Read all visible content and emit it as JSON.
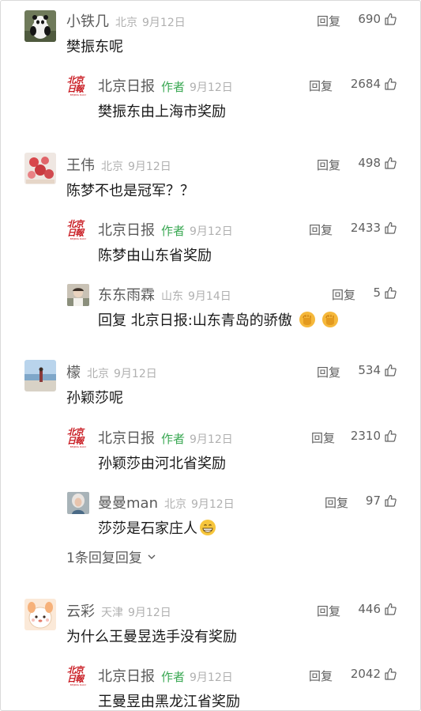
{
  "ui": {
    "reply_label": "回复",
    "author_tag": "作者",
    "colors": {
      "author_green": "#3aa853",
      "text": "#1a1a1a",
      "muted": "#b0b0b0",
      "name": "#5a5a5a"
    }
  },
  "threads": [
    {
      "comment": {
        "user": "小铁几",
        "location": "北京",
        "date": "9月12日",
        "likes": "690",
        "text": "樊振东呢",
        "avatar": "panda-avatar"
      },
      "replies": [
        {
          "user": "北京日报",
          "author": true,
          "date": "9月12日",
          "likes": "2684",
          "text": "樊振东由上海市奖励",
          "avatar": "beijing-daily-logo"
        }
      ]
    },
    {
      "comment": {
        "user": "王伟",
        "location": "北京",
        "date": "9月12日",
        "likes": "498",
        "text": "陈梦不也是冠军？？",
        "avatar": "flowers-avatar"
      },
      "replies": [
        {
          "user": "北京日报",
          "author": true,
          "date": "9月12日",
          "likes": "2433",
          "text": "陈梦由山东省奖励",
          "avatar": "beijing-daily-logo"
        },
        {
          "user": "东东雨霖",
          "location": "山东",
          "date": "9月14日",
          "likes": "5",
          "reply_prefix": "回复",
          "reply_to": "北京日报:",
          "text": "山东青岛的骄傲",
          "emojis": [
            "fist-emoji",
            "fist-emoji"
          ],
          "avatar": "person-avatar"
        }
      ]
    },
    {
      "comment": {
        "user": "檬",
        "location": "北京",
        "date": "9月12日",
        "likes": "534",
        "text": "孙颖莎呢",
        "avatar": "beach-avatar"
      },
      "replies": [
        {
          "user": "北京日报",
          "author": true,
          "date": "9月12日",
          "likes": "2310",
          "text": "孙颖莎由河北省奖励",
          "avatar": "beijing-daily-logo"
        },
        {
          "user": "曼曼man",
          "location": "北京",
          "date": "9月12日",
          "likes": "97",
          "text": "莎莎是石家庄人",
          "emojis": [
            "grin-emoji"
          ],
          "avatar": "portrait-avatar"
        }
      ],
      "more_replies": "1条回复"
    },
    {
      "comment": {
        "user": "云彩",
        "location": "天津",
        "date": "9月12日",
        "likes": "446",
        "text": "为什么王曼昱选手没有奖励",
        "avatar": "cartoon-avatar"
      },
      "replies": [
        {
          "user": "北京日报",
          "author": true,
          "date": "9月12日",
          "likes": "2042",
          "text": "王曼昱由黑龙江省奖励",
          "avatar": "beijing-daily-logo"
        }
      ]
    }
  ]
}
